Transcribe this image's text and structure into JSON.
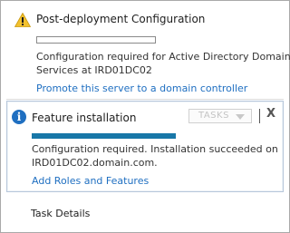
{
  "notifications": [
    {
      "icon": "warning-icon",
      "title": "Post-deployment Configuration",
      "progress": 0,
      "description_lines": [
        "Configuration required for Active Directory Domain",
        "Services at IRD01DC02"
      ],
      "link": "Promote this server to a domain controller"
    },
    {
      "icon": "info-icon",
      "info_glyph": "i",
      "title": "Feature installation",
      "progress": 100,
      "tasks_label": "TASKS",
      "close_glyph": "X",
      "description_lines": [
        "Configuration required. Installation succeeded on",
        "IRD01DC02.domain.com."
      ],
      "link": "Add Roles and Features"
    }
  ],
  "footer": {
    "task_details_label": "Task Details"
  },
  "colors": {
    "warning": "#f2c12e",
    "info": "#1f6fc1",
    "progress": "#1877a8",
    "link": "#1f6fc1"
  }
}
